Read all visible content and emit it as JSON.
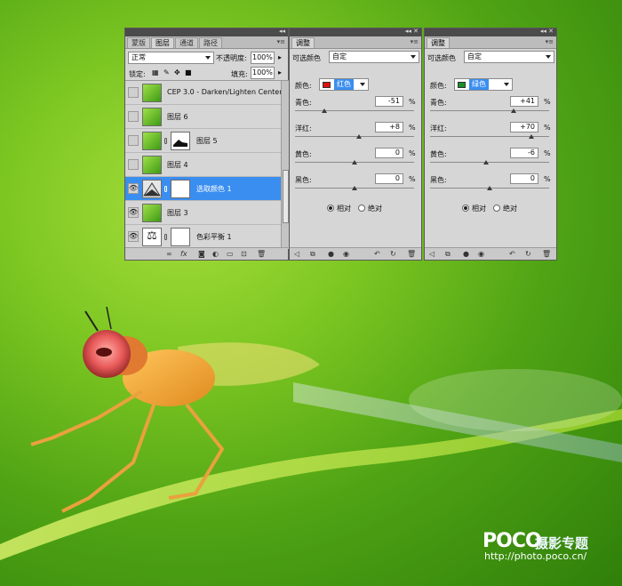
{
  "colors": {
    "panel_bg": "#d6d6d6",
    "selected_layer": "#3a8ef0",
    "red_swatch": "#dd1111",
    "green_swatch": "#1b8f2a",
    "background_green": "#6cbf1e"
  },
  "layers_panel": {
    "tabs": [
      "蒙版",
      "图层",
      "通道",
      "路径"
    ],
    "active_tab": "图层",
    "blend_mode": "正常",
    "opacity_label": "不透明度:",
    "opacity_value": "100%",
    "lock_label": "锁定:",
    "fill_label": "填充:",
    "fill_value": "100%",
    "layers": [
      {
        "name": "CEP 3.0 - Darken/Lighten Center",
        "visible": false,
        "thumb": "green",
        "has_mask": false
      },
      {
        "name": "图层 6",
        "visible": false,
        "thumb": "green",
        "has_mask": false
      },
      {
        "name": "图层 5",
        "visible": false,
        "thumb": "green",
        "has_mask": true
      },
      {
        "name": "图层 4",
        "visible": false,
        "thumb": "green",
        "has_mask": false
      },
      {
        "name": "选取颜色 1",
        "visible": true,
        "thumb": "adjustment",
        "has_mask": true,
        "selected": true
      },
      {
        "name": "图层 3",
        "visible": true,
        "thumb": "green",
        "has_mask": false
      },
      {
        "name": "色彩平衡 1",
        "visible": true,
        "thumb": "balance",
        "has_mask": true
      }
    ],
    "bottom_icons": [
      "link-icon",
      "fx-icon",
      "mask-icon",
      "adjustment-icon",
      "group-icon",
      "new-layer-icon",
      "trash-icon"
    ]
  },
  "adjust_red": {
    "tab": "调整",
    "title": "可选颜色",
    "preset": "自定",
    "color_label": "颜色:",
    "color_value": "红色",
    "sliders": [
      {
        "label": "青色:",
        "value": "-51",
        "unit": "%",
        "level": -51
      },
      {
        "label": "洋红:",
        "value": "+8",
        "unit": "%",
        "level": 8
      },
      {
        "label": "黄色:",
        "value": "0",
        "unit": "%",
        "level": 0
      },
      {
        "label": "黑色:",
        "value": "0",
        "unit": "%",
        "level": 0
      }
    ],
    "relative_label": "相对",
    "absolute_label": "绝对",
    "method": "relative"
  },
  "adjust_green": {
    "tab": "调整",
    "title": "可选颜色",
    "preset": "自定",
    "color_label": "颜色:",
    "color_value": "绿色",
    "sliders": [
      {
        "label": "青色:",
        "value": "+41",
        "unit": "%",
        "level": 41
      },
      {
        "label": "洋红:",
        "value": "+70",
        "unit": "%",
        "level": 70
      },
      {
        "label": "黄色:",
        "value": "-6",
        "unit": "%",
        "level": -6
      },
      {
        "label": "黑色:",
        "value": "0",
        "unit": "%",
        "level": 0
      }
    ],
    "relative_label": "相对",
    "absolute_label": "绝对",
    "method": "relative"
  },
  "watermark": {
    "logo": "POCO",
    "subtitle": "摄影专题",
    "url": "http://photo.poco.cn/"
  }
}
